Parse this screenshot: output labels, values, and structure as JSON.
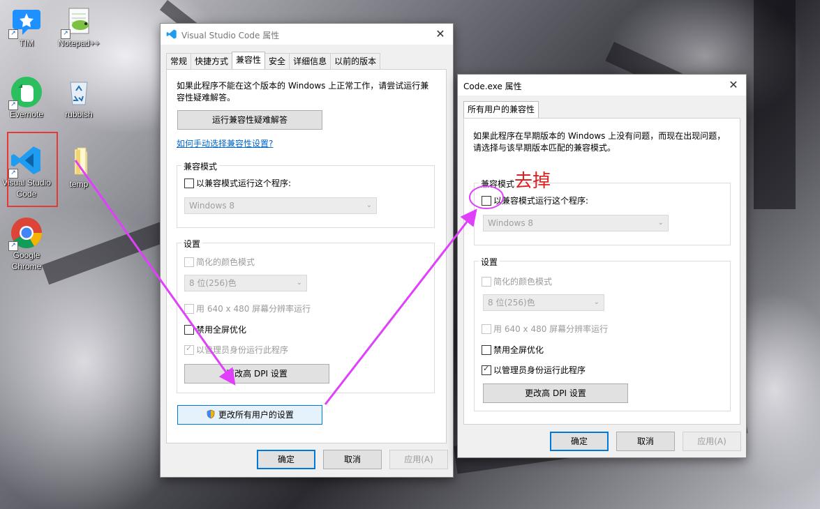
{
  "desktop": {
    "icons": [
      {
        "label": "TIM",
        "icon": "tim-icon"
      },
      {
        "label": "Notepad++",
        "icon": "notepad-plus-plus-icon"
      },
      {
        "label": "Evernote",
        "icon": "evernote-icon"
      },
      {
        "label": "rubbish",
        "icon": "recycle-bin-icon"
      },
      {
        "label": "Visual Studio Code",
        "icon": "vscode-icon"
      },
      {
        "label": "temp",
        "icon": "folder-icon"
      },
      {
        "label": "Google Chrome",
        "icon": "chrome-icon"
      }
    ]
  },
  "dialog1": {
    "title": "Visual Studio Code 属性",
    "close": "✕",
    "tabs": [
      "常规",
      "快捷方式",
      "兼容性",
      "安全",
      "详细信息",
      "以前的版本"
    ],
    "active_tab": 2,
    "intro": "如果此程序不能在这个版本的 Windows 上正常工作，请尝试运行兼容性疑难解答。",
    "troubleshoot_button": "运行兼容性疑难解答",
    "manual_link": "如何手动选择兼容性设置?",
    "compat_group": {
      "title": "兼容模式",
      "checkbox": "以兼容模式运行这个程序:",
      "checked": false,
      "select_value": "Windows 8"
    },
    "settings_group": {
      "title": "设置",
      "reduced_color": "简化的颜色模式",
      "color_select": "8 位(256)色",
      "res_640": "用 640 x 480 屏幕分辨率运行",
      "fullscreen_opt": "禁用全屏优化",
      "run_as_admin": "以管理员身份运行此程序",
      "dpi_button": "更改高 DPI 设置"
    },
    "all_users_button": "更改所有用户的设置",
    "ok": "确定",
    "cancel": "取消",
    "apply": "应用(A)"
  },
  "dialog2": {
    "title": "Code.exe 属性",
    "close": "✕",
    "tab": "所有用户的兼容性",
    "intro": "如果此程序在早期版本的 Windows 上没有问题，而现在出现问题，请选择与该早期版本匹配的兼容模式。",
    "compat_group": {
      "title": "兼容模式",
      "checkbox": "以兼容模式运行这个程序:",
      "checked": false,
      "select_value": "Windows 8"
    },
    "settings_group": {
      "title": "设置",
      "reduced_color": "简化的颜色模式",
      "color_select": "8 位(256)色",
      "res_640": "用 640 x 480 屏幕分辨率运行",
      "fullscreen_opt": "禁用全屏优化",
      "run_as_admin": "以管理员身份运行此程序",
      "run_as_admin_checked": true,
      "dpi_button": "更改高 DPI 设置"
    },
    "ok": "确定",
    "cancel": "取消",
    "apply": "应用(A)"
  },
  "annotation": {
    "note": "去掉",
    "color": "#e02020",
    "arrow_color": "#e040fb"
  }
}
